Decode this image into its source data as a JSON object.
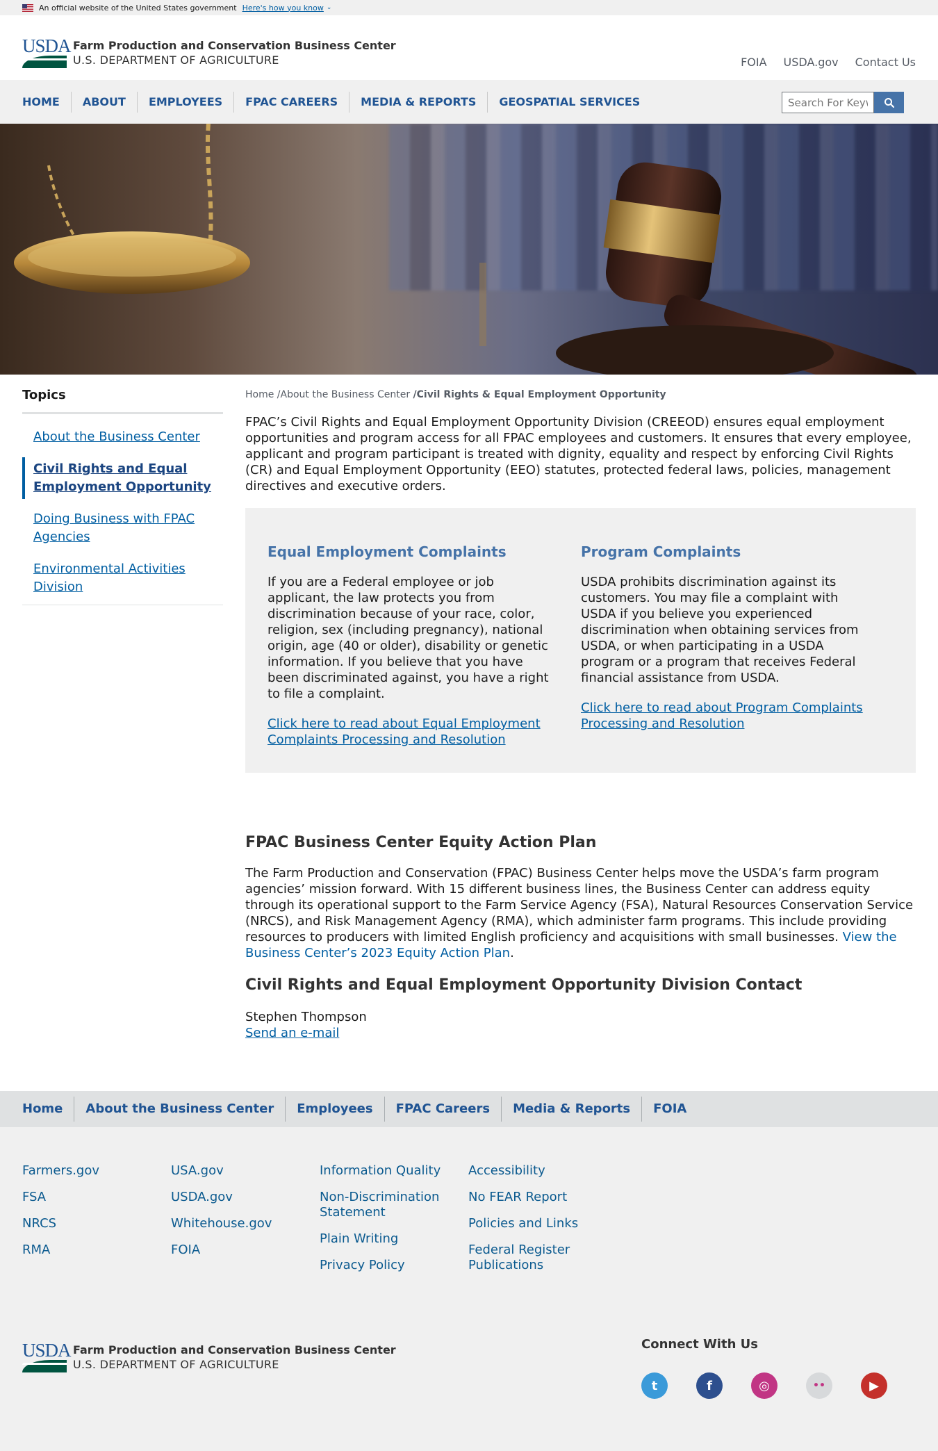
{
  "gov_banner": {
    "text": "An official website of the United States government",
    "link": "Here's how you know"
  },
  "header": {
    "agency": "Farm Production and Conservation Business Center",
    "department": "U.S. DEPARTMENT OF AGRICULTURE",
    "logo_letters": "USDA",
    "top_links": [
      "FOIA",
      "USDA.gov",
      "Contact Us"
    ]
  },
  "nav": {
    "items": [
      "HOME",
      "ABOUT",
      "EMPLOYEES",
      "FPAC CAREERS",
      "MEDIA & REPORTS",
      "GEOSPATIAL SERVICES"
    ]
  },
  "search": {
    "placeholder": "Search For Keywords"
  },
  "sidebar": {
    "title": "Topics",
    "items": [
      {
        "label": "About the Business Center",
        "active": false
      },
      {
        "label": "Civil Rights and Equal Employment Opportunity",
        "active": true
      },
      {
        "label": "Doing Business with FPAC Agencies",
        "active": false
      },
      {
        "label": "Environmental Activities Division",
        "active": false
      }
    ]
  },
  "breadcrumb": {
    "home": "Home",
    "sep": " /",
    "parent": "About the Business Center",
    "current": "/Civil Rights & Equal Employment Opportunity"
  },
  "intro": "FPAC’s Civil Rights and Equal Employment Opportunity Division (CREEOD) ensures equal employment opportunities and program access for all FPAC employees and customers. It ensures that every employee, applicant and program participant is treated with dignity, equality and respect by enforcing Civil Rights (CR) and Equal Employment Opportunity (EEO) statutes, protected federal laws, policies, management directives and executive orders.",
  "panel": {
    "eeo": {
      "heading": "Equal Employment Complaints",
      "body": "If you are a Federal employee or job applicant, the law protects you from discrimination because of your race, color, religion, sex (including pregnancy), national origin, age (40 or older), disability or genetic information. If you believe that you have been discriminated against, you have a right to file a complaint.",
      "link": "Click here to read about Equal Employment Complaints Processing and Resolution"
    },
    "program": {
      "heading": "Program Complaints",
      "body": "USDA prohibits discrimination against its customers. You may file a complaint with USDA if you believe you experienced discrimination when obtaining services from USDA, or when participating in a USDA program or a program that receives Federal financial assistance from USDA.",
      "link": "Click here to read about Program Complaints Processing and Resolution"
    }
  },
  "equity": {
    "heading": "FPAC Business Center Equity Action Plan",
    "body": "The Farm Production and Conservation (FPAC) Business Center helps move the USDA’s farm program agencies’ mission forward. With 15 different business lines, the Business Center can address equity through its operational support to the Farm Service Agency (FSA), Natural Resources Conservation Service (NRCS), and Risk Management Agency (RMA), which administer farm programs. This include providing resources to producers with limited English proficiency and acquisitions with small businesses. ",
    "link": "View the Business Center’s 2023 Equity Action Plan",
    "period": "."
  },
  "contact": {
    "heading": "Civil Rights and Equal Employment Opportunity Division Contact",
    "name": "Stephen Thompson",
    "email_link": "Send an e-mail"
  },
  "footer_nav": {
    "items": [
      "Home",
      "About the Business Center",
      "Employees",
      "FPAC Careers",
      "Media & Reports",
      "FOIA"
    ]
  },
  "footer_links": {
    "col1": [
      "Farmers.gov",
      "FSA",
      "NRCS",
      "RMA"
    ],
    "col2": [
      "USA.gov",
      "USDA.gov",
      "Whitehouse.gov",
      "FOIA"
    ],
    "col3": [
      "Information Quality",
      "Non-Discrimination Statement",
      "Plain Writing",
      "Privacy Policy"
    ],
    "col4": [
      "Accessibility",
      "No FEAR Report",
      "Policies and Links",
      "Federal Register Publications"
    ]
  },
  "connect": {
    "title": "Connect With Us",
    "socials": [
      {
        "name": "twitter-icon",
        "color": "#3a9ad9",
        "glyph": "t"
      },
      {
        "name": "facebook-icon",
        "color": "#2d4f8e",
        "glyph": "f"
      },
      {
        "name": "instagram-icon",
        "color": "#c13584",
        "glyph": "◎"
      },
      {
        "name": "flickr-icon",
        "color": "#d7d9db",
        "glyph": "••"
      },
      {
        "name": "youtube-icon",
        "color": "#c4302b",
        "glyph": "▶"
      }
    ]
  }
}
